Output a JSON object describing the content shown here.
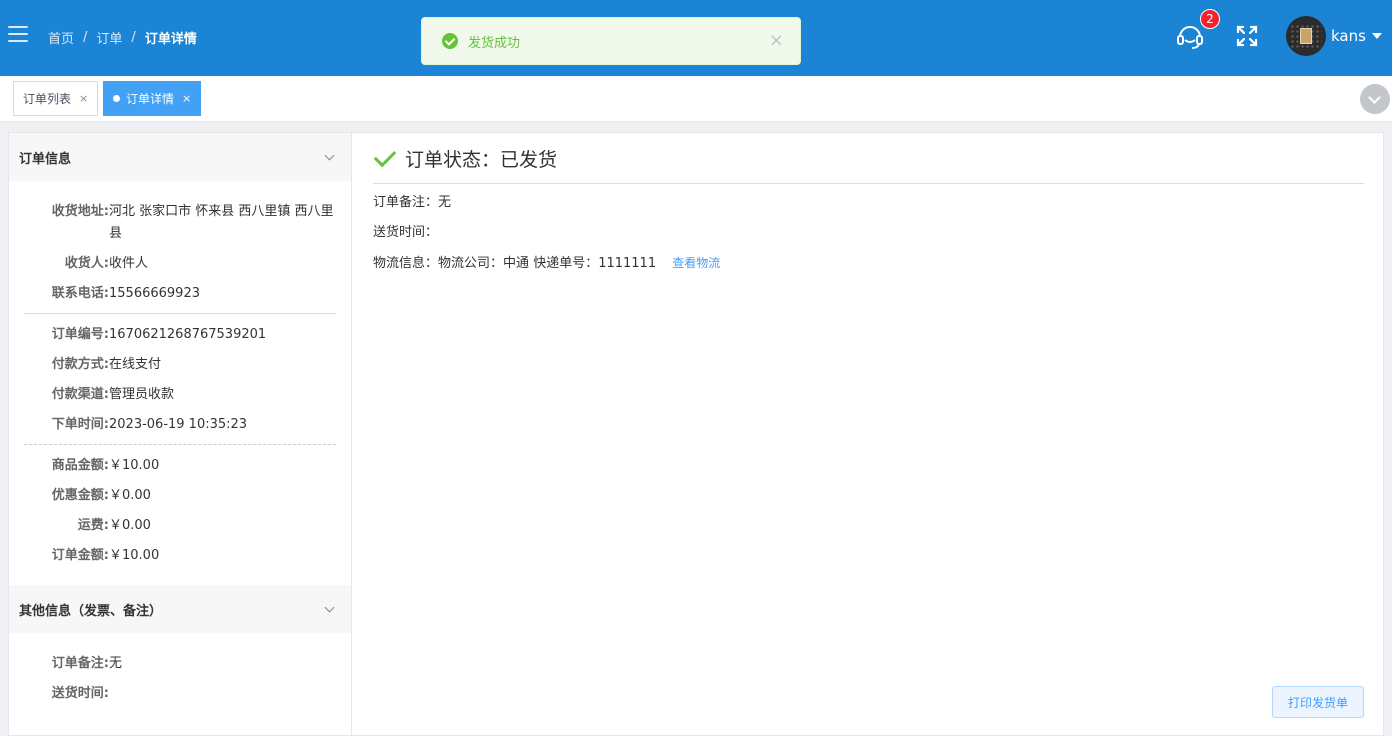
{
  "header": {
    "breadcrumb": [
      "首页",
      "订单",
      "订单详情"
    ],
    "breadcrumb_sep": "/",
    "notification_count": "2",
    "username": "kans"
  },
  "toast": {
    "message": "发货成功",
    "close": "×"
  },
  "tabs": [
    {
      "label": "订单列表",
      "close": "×",
      "active": false
    },
    {
      "label": "订单详情",
      "close": "×",
      "active": true
    }
  ],
  "order_panel": {
    "title": "订单信息",
    "address_label": "收货地址:",
    "address": "河北 张家口市 怀来县 西八里镇 西八里县",
    "receiver_label": "收货人:",
    "receiver": "收件人",
    "phone_label": "联系电话:",
    "phone": "15566669923",
    "order_no_label": "订单编号:",
    "order_no": "1670621268767539201",
    "pay_method_label": "付款方式:",
    "pay_method": "在线支付",
    "pay_channel_label": "付款渠道:",
    "pay_channel": "管理员收款",
    "order_time_label": "下单时间:",
    "order_time": "2023-06-19 10:35:23",
    "goods_amount_label": "商品金额:",
    "goods_amount": "￥10.00",
    "discount_label": "优惠金额:",
    "discount": "￥0.00",
    "freight_label": "运费:",
    "freight": "￥0.00",
    "order_amount_label": "订单金额:",
    "order_amount": "￥10.00"
  },
  "other_panel": {
    "title": "其他信息（发票、备注）",
    "remark_label": "订单备注:",
    "remark": "无",
    "delivery_time_label": "送货时间:",
    "delivery_time": ""
  },
  "status": {
    "text": "订单状态：已发货",
    "remark_label": "订单备注：",
    "remark": "无",
    "delivery_time_label": "送货时间：",
    "logistics_label": "物流信息：",
    "logistics_company_label": "物流公司：",
    "logistics_company": "中通",
    "tracking_label": "快递单号：",
    "tracking_no": "1111111",
    "view_logistics": "查看物流",
    "print_button": "打印发货单"
  },
  "colors": {
    "header_bg": "#1b84d4",
    "active_tab": "#42a0f5",
    "success": "#67c23a",
    "link": "#409eff"
  }
}
